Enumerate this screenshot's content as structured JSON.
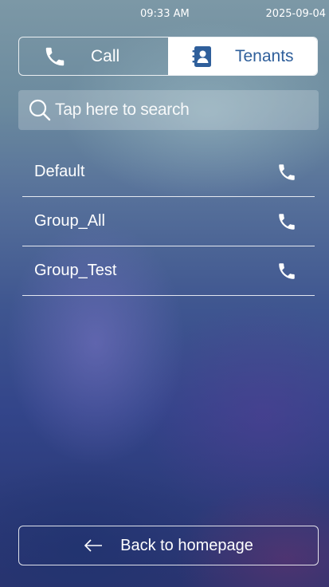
{
  "status_bar": {
    "time": "09:33 AM",
    "date": "2025-09-04"
  },
  "tabs": [
    {
      "label": "Call",
      "icon": "phone-icon",
      "active": false
    },
    {
      "label": "Tenants",
      "icon": "contacts-icon",
      "active": true
    }
  ],
  "search": {
    "placeholder": "Tap here to search",
    "icon": "search-icon"
  },
  "groups": [
    {
      "name": "Default"
    },
    {
      "name": "Group_All"
    },
    {
      "name": "Group_Test"
    }
  ],
  "back_button": {
    "label": "Back to homepage",
    "icon": "arrow-left-icon"
  },
  "colors": {
    "active_tab_bg": "#ffffff",
    "active_tab_text": "#2f5f9b",
    "text": "#ffffff"
  }
}
